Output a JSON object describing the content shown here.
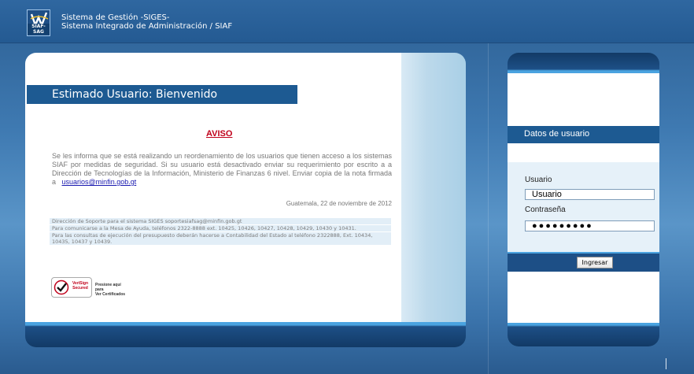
{
  "header": {
    "logo_text": "SIAF-SAG",
    "title_line1": "Sistema de Gestión -SIGES-",
    "title_line2": "Sistema Integrado de Administración / SIAF"
  },
  "main": {
    "welcome": "Estimado Usuario: Bienvenido",
    "aviso": "AVISO",
    "body_text": "Se les informa que se está realizando un reordenamiento de los usuarios que tienen acceso a los sistemas SIAF por medidas de seguridad. Si su usuario está desactivado enviar su requerimiento por escrito a a Dirección de Tecnologías de la Información, Ministerio de Finanzas 6 nivel. Enviar copia de la nota firmada a",
    "email_link": "usuarios@minfin.gob.gt",
    "date": "Guatemala, 22 de noviembre de 2012",
    "info_lines": [
      "Dirección de Soporte para el sistema SIGES soportesiafsag@minfin.gob.gt",
      "Para comunicarse a la Mesa de Ayuda, teléfonos 2322-8888 ext. 10425, 10426, 10427, 10428, 10429, 10430 y 10431.",
      "Para las consultas de ejecución del presupuesto deberán hacerse a Contabilidad del Estado al teléfono 2322888, Ext. 10434, 10435, 10437 y 10439."
    ],
    "verisign": {
      "seal_name": "VeriSign Secured",
      "link_line1": "Presione aquí para",
      "link_line2": "Ver Certificados"
    }
  },
  "login": {
    "section_title": "Datos de usuario",
    "user_label": "Usuario",
    "user_value": "Usuario",
    "password_label": "Contraseña",
    "password_value": "●●●●●●●●●",
    "submit_label": "Ingresar"
  },
  "colors": {
    "brand_blue": "#1d5a92",
    "accent_light_blue": "#4aa3e0",
    "aviso_red": "#c0001a",
    "link_blue": "#1a1ab0"
  }
}
